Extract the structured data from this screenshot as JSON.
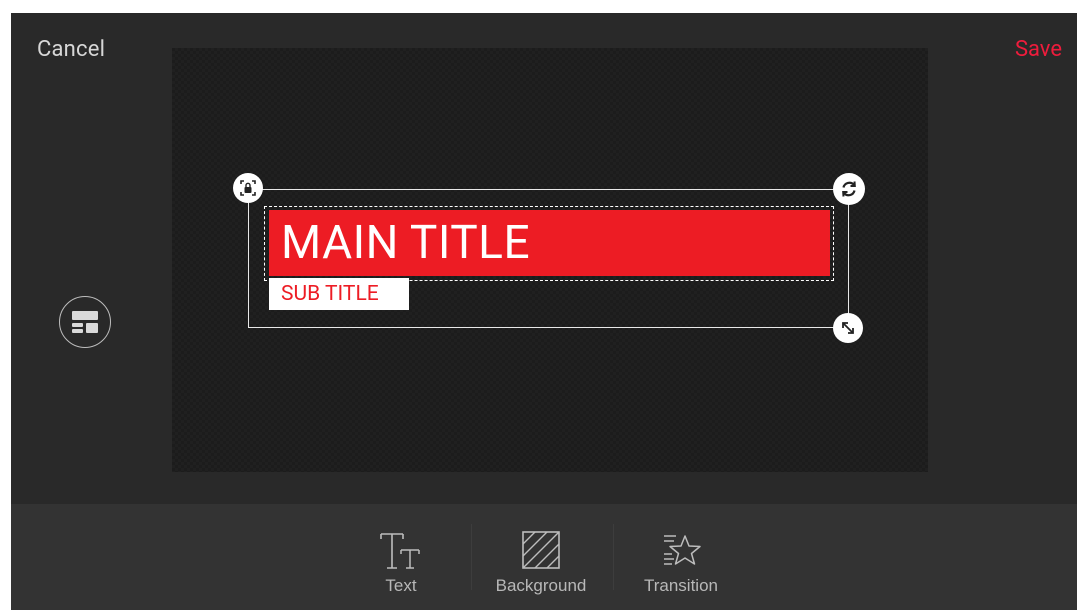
{
  "header": {
    "cancel_label": "Cancel",
    "save_label": "Save"
  },
  "canvas": {
    "main_title": "MAIN TITLE",
    "sub_title": "SUB TITLE"
  },
  "toolbar": {
    "items": [
      {
        "label": "Text",
        "icon": "text-icon"
      },
      {
        "label": "Background",
        "icon": "background-icon"
      },
      {
        "label": "Transition",
        "icon": "transition-icon"
      }
    ]
  },
  "colors": {
    "accent": "#ee1c3c",
    "title_bar": "#ed1c24",
    "editor_bg": "#292929",
    "toolbar_bg": "#333333"
  }
}
